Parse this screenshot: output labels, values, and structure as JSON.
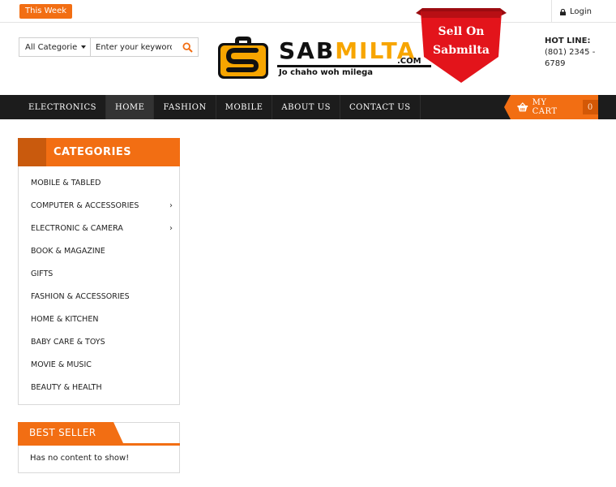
{
  "topbar": {
    "this_week": "This Week",
    "login": "Login"
  },
  "search": {
    "category": "All Categorie",
    "placeholder": "Enter your keyword..."
  },
  "logo": {
    "word_dark": "SAB",
    "word_accent": "MILTA",
    "dotcom": ".COM",
    "tagline": "Jo chaho woh milega"
  },
  "ribbon": {
    "line1": "Sell On",
    "line2": "Sabmilta"
  },
  "hotline": {
    "label": "HOT LINE:",
    "number": "(801) 2345 - 6789"
  },
  "nav": {
    "items": [
      {
        "label": "ELECTRONICS",
        "active": false
      },
      {
        "label": "HOME",
        "active": true
      },
      {
        "label": "FASHION",
        "active": false
      },
      {
        "label": "MOBILE",
        "active": false
      },
      {
        "label": "ABOUT US",
        "active": false
      },
      {
        "label": "CONTACT US",
        "active": false
      }
    ]
  },
  "cart": {
    "label": "MY CART",
    "count": "0"
  },
  "categories": {
    "title": "CATEGORIES",
    "items": [
      {
        "label": "MOBILE & TABLED",
        "has_sub": false
      },
      {
        "label": "COMPUTER & ACCESSORIES",
        "has_sub": true
      },
      {
        "label": "ELECTRONIC & CAMERA",
        "has_sub": true
      },
      {
        "label": "BOOK & MAGAZINE",
        "has_sub": false
      },
      {
        "label": "GIFTS",
        "has_sub": false
      },
      {
        "label": "FASHION & ACCESSORIES",
        "has_sub": false
      },
      {
        "label": "HOME & KITCHEN",
        "has_sub": false
      },
      {
        "label": "BABY CARE & TOYS",
        "has_sub": false
      },
      {
        "label": "MOVIE & MUSIC",
        "has_sub": false
      },
      {
        "label": "BEAUTY & HEALTH",
        "has_sub": false
      }
    ]
  },
  "best_seller": {
    "title": "BEST SELLER",
    "empty_text": "Has no content to show!"
  },
  "colors": {
    "accent": "#f26e13",
    "accent_dark": "#c95a0d",
    "nav_bg": "#1c1c1c",
    "ribbon": "#e3141b",
    "logo_gold": "#f7a500"
  },
  "icons": {
    "login": "lock-icon",
    "search": "search-icon",
    "cart": "basket-icon",
    "submenu": "chevron-right-icon"
  }
}
